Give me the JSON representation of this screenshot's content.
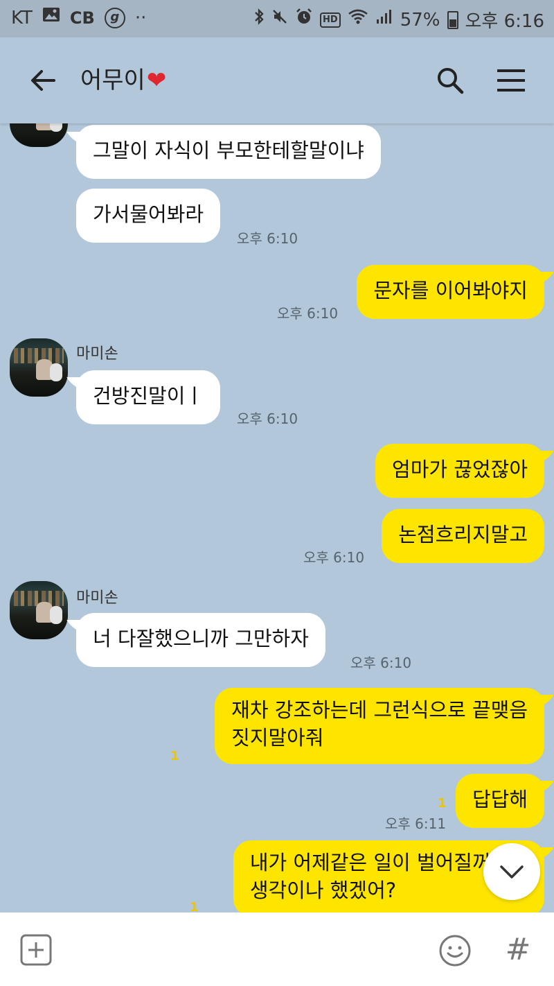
{
  "status_bar": {
    "carrier": "KT",
    "cb": "CB",
    "g_badge": "g",
    "more": "··",
    "hd": "HD",
    "battery": "57%",
    "time": "오후 6:16"
  },
  "header": {
    "title": "어무이",
    "title_emoji": "❤",
    "back_icon": "back-arrow-icon",
    "search_icon": "search-icon",
    "menu_icon": "hamburger-menu-icon"
  },
  "messages": [
    {
      "side": "in",
      "text": "그말이 자식이 부모한테할말이냐"
    },
    {
      "side": "in",
      "text": "가서물어봐라",
      "time": "오후 6:10"
    },
    {
      "side": "out",
      "text": "문자를 이어봐야지",
      "time": "오후 6:10"
    },
    {
      "side": "in",
      "sender": "마미손",
      "text": "건방진말이ㅣ",
      "time": "오후 6:10"
    },
    {
      "side": "out",
      "text": "엄마가 끊었잖아"
    },
    {
      "side": "out",
      "text": "논점흐리지말고",
      "time": "오후 6:10"
    },
    {
      "side": "in",
      "sender": "마미손",
      "text": "너 다잘했으니까 그만하자",
      "time": "오후 6:10"
    },
    {
      "side": "out",
      "text": "재차 강조하는데 그런식으로 끝맺음\n짓지말아줘",
      "unread": "1"
    },
    {
      "side": "out",
      "text": "답답해",
      "unread": "1",
      "time": "오후 6:11"
    },
    {
      "side": "out",
      "text": "내가 어제같은 일이 벌어질꺼라고\n생각이나 했겠어?",
      "unread": "1"
    }
  ],
  "input": {
    "attach_icon": "plus-square-icon",
    "emoji_icon": "emoji-icon",
    "hash_label": "#"
  },
  "colors": {
    "chat_bg": "#b2c7da",
    "incoming_bubble": "#ffffff",
    "outgoing_bubble": "#fee500",
    "unread_count": "#f0c400"
  }
}
